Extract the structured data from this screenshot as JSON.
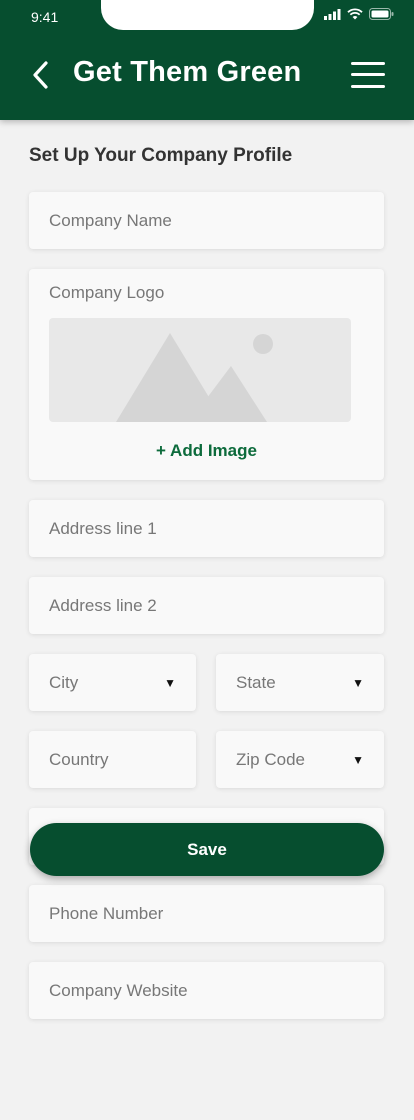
{
  "status_bar": {
    "time": "9:41"
  },
  "header": {
    "title": "Get Them Green"
  },
  "page": {
    "title": "Set Up Your Company Profile"
  },
  "form": {
    "company_name": "Company Name",
    "company_logo": "Company Logo",
    "add_image": "+ Add Image",
    "address_line_1": "Address line 1",
    "address_line_2": "Address line 2",
    "city": "City",
    "state": "State",
    "country": "Country",
    "zip_code": "Zip Code",
    "phone_number": "Phone Number",
    "company_website": "Company Website",
    "save": "Save"
  },
  "colors": {
    "brand": "#064e2f",
    "accent": "#0d6b3c"
  }
}
